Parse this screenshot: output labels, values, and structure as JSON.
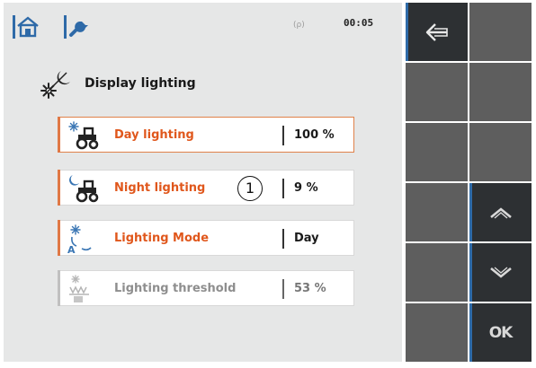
{
  "topbar": {
    "home_icon": "home-icon",
    "tool_icon": "wrench-icon",
    "signal": "(ρ)",
    "time": "00:05"
  },
  "page": {
    "title": "Display lighting",
    "icon": "day-night-icon"
  },
  "rows": [
    {
      "label": "Day lighting",
      "value": "100 %",
      "icon": "day-tractor-icon",
      "selected": true
    },
    {
      "label": "Night lighting",
      "value": "9 %",
      "icon": "night-tractor-icon",
      "marker": "1"
    },
    {
      "label": "Lighting Mode",
      "value": "Day",
      "icon": "auto-mode-icon"
    },
    {
      "label": "Lighting threshold",
      "value": "53 %",
      "icon": "threshold-icon",
      "disabled": true
    }
  ],
  "softkeys": {
    "back_icon": "back-arrow-icon",
    "up_icon": "chevron-up-icon",
    "down_icon": "chevron-down-icon",
    "ok_label": "OK"
  },
  "colors": {
    "accent_orange": "#e0571c",
    "accent_blue": "#2e6aa8",
    "softkey_grey": "#5e5e5e",
    "softkey_dark": "#2d3033"
  }
}
